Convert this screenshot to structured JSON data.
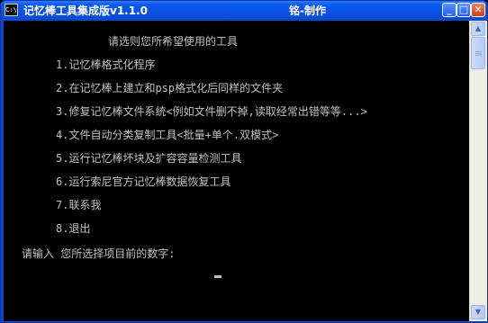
{
  "window": {
    "app_icon": "C:\\",
    "title": "记忆棒工具集成版v1.1.0",
    "author": "铭-制作",
    "minimize_symbol": "_",
    "maximize_symbol": "□",
    "close_symbol": "✕"
  },
  "console": {
    "heading": "请选则您所希望使用的工具",
    "menu_items": [
      "1.记忆棒格式化程序",
      "2.在记忆棒上建立和psp格式化后同样的文件夹",
      "3.修复记忆棒文件系统<例如文件删不掉,读取经常出错等等...>",
      "4.文件自动分类复制工具<批量+单个.双模式>",
      "5.运行记忆棒坏块及扩容容量检测工具",
      "6.运行索尼官方记忆棒数据恢复工具",
      "7.联系我",
      "8.退出"
    ],
    "prompt": "请输入 您所选择项目前的数字:"
  },
  "scrollbar": {
    "up_symbol": "▲",
    "down_symbol": "▼"
  }
}
